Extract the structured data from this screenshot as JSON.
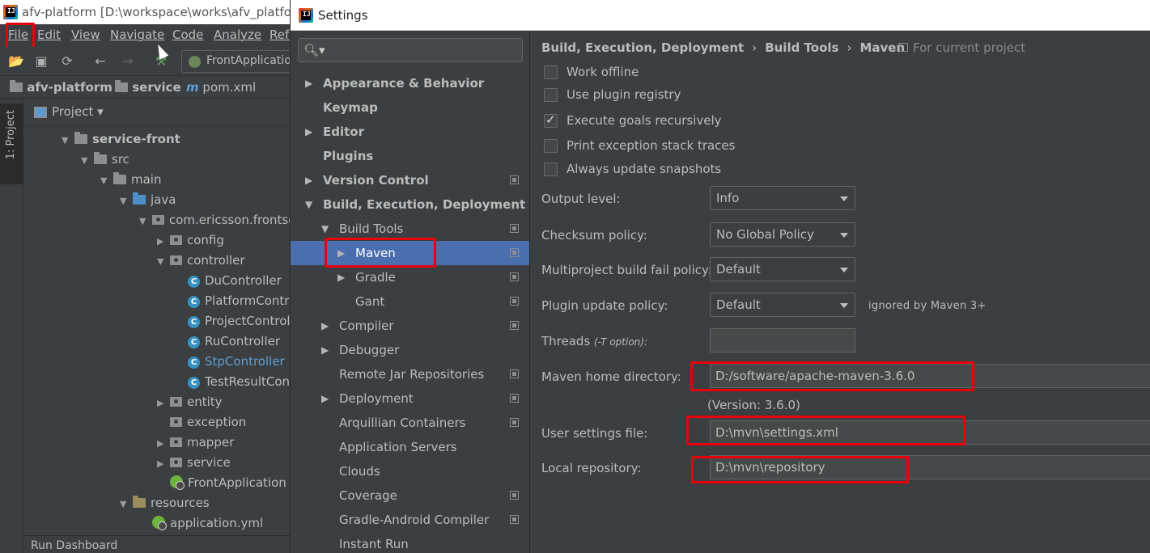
{
  "ide": {
    "title": "afv-platform [D:\\workspace\\works\\afv_platform] g",
    "menu": [
      "File",
      "Edit",
      "View",
      "Navigate",
      "Code",
      "Analyze",
      "Refa"
    ],
    "run_config": "FrontApplication",
    "breadcrumb": [
      "afv-platform",
      "service",
      "pom.xml"
    ],
    "side_tab": "1: Project",
    "project_view": "Project",
    "tree": [
      {
        "label": "service-front",
        "arrow": "▼",
        "type": "module",
        "bold": true
      },
      {
        "label": "src",
        "arrow": "▼",
        "type": "folder"
      },
      {
        "label": "main",
        "arrow": "▼",
        "type": "folder"
      },
      {
        "label": "java",
        "arrow": "▼",
        "type": "source"
      },
      {
        "label": "com.ericsson.frontservice",
        "arrow": "▼",
        "type": "package"
      },
      {
        "label": "config",
        "arrow": "▶",
        "type": "package"
      },
      {
        "label": "controller",
        "arrow": "▼",
        "type": "package"
      },
      {
        "label": "DuController",
        "arrow": "",
        "type": "class"
      },
      {
        "label": "PlatformController",
        "arrow": "",
        "type": "class"
      },
      {
        "label": "ProjectController",
        "arrow": "",
        "type": "class"
      },
      {
        "label": "RuController",
        "arrow": "",
        "type": "class"
      },
      {
        "label": "StpController",
        "arrow": "",
        "type": "class",
        "highlight": true
      },
      {
        "label": "TestResultController",
        "arrow": "",
        "type": "class"
      },
      {
        "label": "entity",
        "arrow": "▶",
        "type": "package"
      },
      {
        "label": "exception",
        "arrow": "",
        "type": "package"
      },
      {
        "label": "mapper",
        "arrow": "▶",
        "type": "package"
      },
      {
        "label": "service",
        "arrow": "▶",
        "type": "package"
      },
      {
        "label": "FrontApplication",
        "arrow": "",
        "type": "spring"
      },
      {
        "label": "resources",
        "arrow": "▼",
        "type": "resources"
      },
      {
        "label": "application.yml",
        "arrow": "",
        "type": "spring"
      }
    ],
    "run_dashboard": "Run Dashboard"
  },
  "settings": {
    "title": "Settings",
    "search_placeholder": "",
    "nav": [
      {
        "label": "Appearance & Behavior",
        "arrow": "▶",
        "indent": 0,
        "bold": true
      },
      {
        "label": "Keymap",
        "arrow": "",
        "indent": 0,
        "bold": true
      },
      {
        "label": "Editor",
        "arrow": "▶",
        "indent": 0,
        "bold": true
      },
      {
        "label": "Plugins",
        "arrow": "",
        "indent": 0,
        "bold": true
      },
      {
        "label": "Version Control",
        "arrow": "▶",
        "indent": 0,
        "bold": true,
        "project": true
      },
      {
        "label": "Build, Execution, Deployment",
        "arrow": "▼",
        "indent": 0,
        "bold": true
      },
      {
        "label": "Build Tools",
        "arrow": "▼",
        "indent": 1,
        "project": true
      },
      {
        "label": "Maven",
        "arrow": "▶",
        "indent": 2,
        "project": true,
        "selected": true
      },
      {
        "label": "Gradle",
        "arrow": "▶",
        "indent": 2,
        "project": true
      },
      {
        "label": "Gant",
        "arrow": "",
        "indent": 2,
        "project": true
      },
      {
        "label": "Compiler",
        "arrow": "▶",
        "indent": 1,
        "project": true
      },
      {
        "label": "Debugger",
        "arrow": "▶",
        "indent": 1
      },
      {
        "label": "Remote Jar Repositories",
        "arrow": "",
        "indent": 1,
        "project": true
      },
      {
        "label": "Deployment",
        "arrow": "▶",
        "indent": 1,
        "project": true
      },
      {
        "label": "Arquillian Containers",
        "arrow": "",
        "indent": 1,
        "project": true
      },
      {
        "label": "Application Servers",
        "arrow": "",
        "indent": 1
      },
      {
        "label": "Clouds",
        "arrow": "",
        "indent": 1
      },
      {
        "label": "Coverage",
        "arrow": "",
        "indent": 1,
        "project": true
      },
      {
        "label": "Gradle-Android Compiler",
        "arrow": "",
        "indent": 1,
        "project": true
      },
      {
        "label": "Instant Run",
        "arrow": "",
        "indent": 1
      }
    ],
    "crumbs": [
      "Build, Execution, Deployment",
      "Build Tools",
      "Maven"
    ],
    "crumb_sep": "›",
    "for_current_project": "For current project",
    "checkboxes": [
      {
        "label": "Work offline",
        "checked": false
      },
      {
        "label": "Use plugin registry",
        "checked": false
      },
      {
        "label": "Execute goals recursively",
        "checked": true
      },
      {
        "label": "Print exception stack traces",
        "checked": false
      },
      {
        "label": "Always update snapshots",
        "checked": false
      }
    ],
    "output_level": {
      "label": "Output level:",
      "value": "Info"
    },
    "checksum_policy": {
      "label": "Checksum policy:",
      "value": "No Global Policy"
    },
    "multiproject_fail_policy": {
      "label": "Multiproject build fail policy:",
      "value": "Default"
    },
    "plugin_update_policy": {
      "label": "Plugin update policy:",
      "value": "Default",
      "note": "ignored by Maven 3+"
    },
    "threads": {
      "label": "Threads",
      "hint": "(-T option):",
      "value": ""
    },
    "maven_home": {
      "label": "Maven home directory:",
      "value": "D:/software/apache-maven-3.6.0",
      "version": "(Version: 3.6.0)"
    },
    "user_settings": {
      "label": "User settings file:",
      "value": "D:\\mvn\\settings.xml"
    },
    "local_repo": {
      "label": "Local repository:",
      "value": "D:\\mvn\\repository"
    }
  },
  "colors": {
    "highlight": "#e8000b",
    "selection": "#4b6eaf",
    "background": "#3c3f41",
    "link_class": "#5f9fd6"
  }
}
